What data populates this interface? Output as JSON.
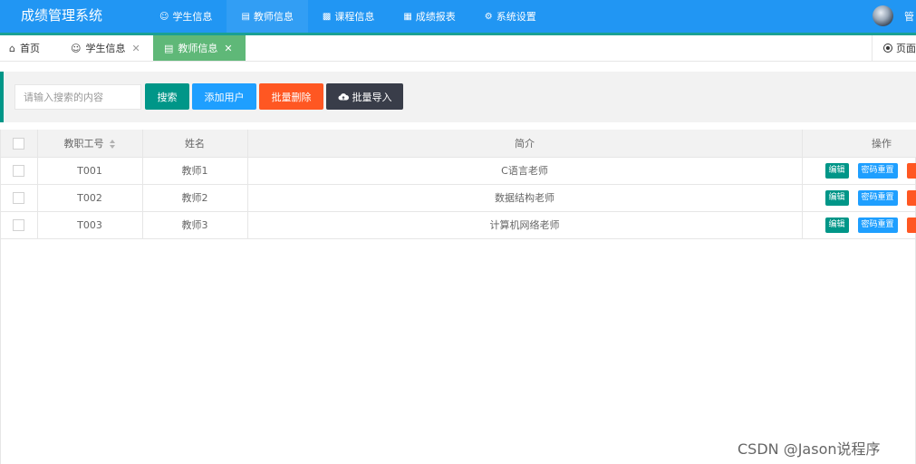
{
  "header": {
    "title": "成绩管理系统",
    "nav": [
      {
        "label": "学生信息",
        "icon": "users-icon"
      },
      {
        "label": "教师信息",
        "icon": "file-icon"
      },
      {
        "label": "课程信息",
        "icon": "book-icon"
      },
      {
        "label": "成绩报表",
        "icon": "table-icon"
      },
      {
        "label": "系统设置",
        "icon": "gear-icon"
      }
    ],
    "user_name": "管",
    "colors": {
      "bar": "#2196f3",
      "accent": "#1aa094"
    }
  },
  "tabs": {
    "items": [
      {
        "label": "首页",
        "icon": "home-icon"
      },
      {
        "label": "学生信息",
        "icon": "users-icon"
      },
      {
        "label": "教师信息",
        "icon": "file-icon"
      }
    ],
    "page_ops_label": "页面",
    "active_color": "#5fb878"
  },
  "search": {
    "placeholder": "请输入搜索的内容",
    "search_label": "搜索",
    "add_label": "添加用户",
    "delete_label": "批量删除",
    "import_label": "批量导入"
  },
  "table": {
    "headers": {
      "id": "教职工号",
      "name": "姓名",
      "intro": "简介",
      "ops": "操作"
    },
    "rows": [
      {
        "id": "T001",
        "name": "教师1",
        "intro": "C语言老师"
      },
      {
        "id": "T002",
        "name": "教师2",
        "intro": "数据结构老师"
      },
      {
        "id": "T003",
        "name": "教师3",
        "intro": "计算机网络老师"
      }
    ],
    "edit_label": "编辑",
    "reset_label": "密码重置"
  },
  "watermark": "CSDN @Jason说程序"
}
